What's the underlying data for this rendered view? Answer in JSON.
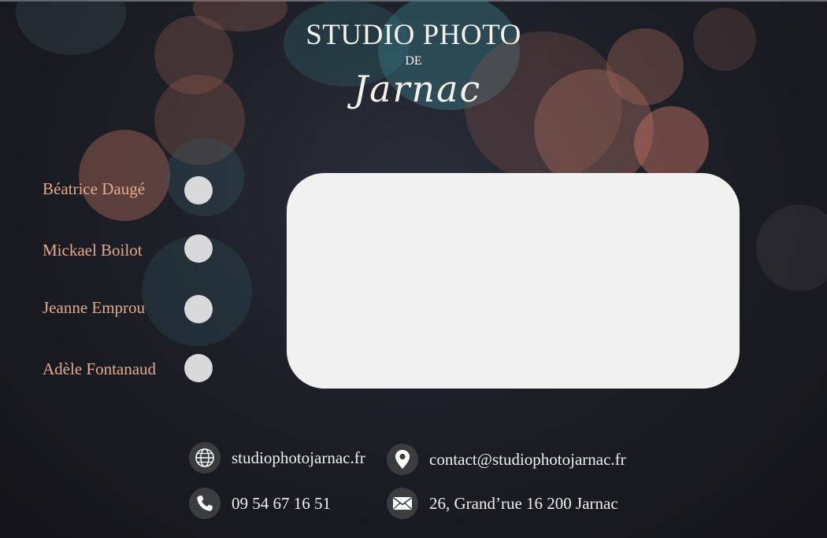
{
  "brand": {
    "title_line1": "STUDIO PHOTO",
    "title_line2": "DE",
    "title_line3": "Jarnac"
  },
  "staff": [
    {
      "name": "Béatrice Daugé"
    },
    {
      "name": "Mickael Boilot"
    },
    {
      "name": "Jeanne Emprou"
    },
    {
      "name": "Adèle Fontanaud"
    }
  ],
  "contacts": {
    "website": {
      "text": "studiophotojarnac.fr",
      "icon": "globe-icon"
    },
    "email": {
      "text": "contact@studiophotojarnac.fr",
      "icon": "location-pin-icon"
    },
    "phone": {
      "text": "09 54 67 16 51",
      "icon": "phone-icon"
    },
    "address": {
      "text": "26, Grand’rue 16 200 Jarnac",
      "icon": "envelope-icon"
    }
  },
  "colors": {
    "name_text": "#e3a98a",
    "radio_fill": "#d9d9dc",
    "panel": "#f1f1f1",
    "icon_circle": "#3b3c40",
    "contact_text": "#f0efee"
  }
}
